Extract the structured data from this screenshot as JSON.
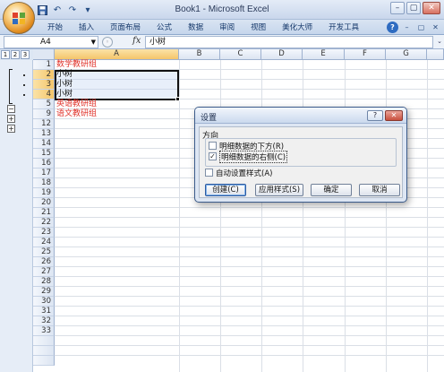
{
  "window": {
    "title": "Book1 - Microsoft Excel",
    "controls": {
      "minimize": "–",
      "restore": "▢",
      "close": "✕"
    }
  },
  "quick_access": {
    "save_icon": "save-icon",
    "undo_icon": "undo-icon",
    "redo_icon": "redo-icon",
    "more_icon": "chevron-down-icon"
  },
  "ribbon": {
    "tabs": [
      "开始",
      "插入",
      "页面布局",
      "公式",
      "数据",
      "审阅",
      "视图",
      "美化大师",
      "开发工具"
    ],
    "help_label": "?",
    "window_minimize": "–",
    "window_restore": "▢",
    "window_close": "✕"
  },
  "formula_bar": {
    "name_box": "A4",
    "fx": "fx",
    "value": "小树"
  },
  "outline": {
    "levels": [
      "1",
      "2",
      "3"
    ],
    "minus": "−",
    "plus": "+"
  },
  "sheet": {
    "columns": [
      "A",
      "B",
      "C",
      "D",
      "E",
      "F",
      "G"
    ],
    "rows": [
      "1",
      "2",
      "3",
      "4",
      "5",
      "9",
      "12",
      "13",
      "14",
      "15",
      "16",
      "17",
      "18",
      "19",
      "20",
      "21",
      "22",
      "23",
      "24",
      "25",
      "26",
      "27",
      "28",
      "29",
      "30",
      "31",
      "32",
      "33"
    ],
    "cells": [
      {
        "row": "1",
        "text": "数学教研组",
        "color": "#e0322a"
      },
      {
        "row": "2",
        "text": "小树",
        "color": "#111111"
      },
      {
        "row": "3",
        "text": "小树",
        "color": "#111111"
      },
      {
        "row": "4",
        "text": "小树",
        "color": "#111111"
      },
      {
        "row": "5",
        "text": "英语教研组",
        "color": "#e0322a"
      },
      {
        "row": "9",
        "text": "语文教研组",
        "color": "#e0322a"
      }
    ]
  },
  "dialog": {
    "title": "设置",
    "help": "?",
    "close": "✕",
    "group_label": "方向",
    "options": [
      {
        "label": "明细数据的下方(R)",
        "checked": false
      },
      {
        "label": "明细数据的右侧(C)",
        "checked": true
      }
    ],
    "auto_style": {
      "label": "自动设置样式(A)",
      "checked": false
    },
    "check_mark": "✓",
    "buttons": {
      "create": "创建(C)",
      "apply_styles": "应用样式(S)",
      "ok": "确定",
      "cancel": "取消"
    }
  }
}
